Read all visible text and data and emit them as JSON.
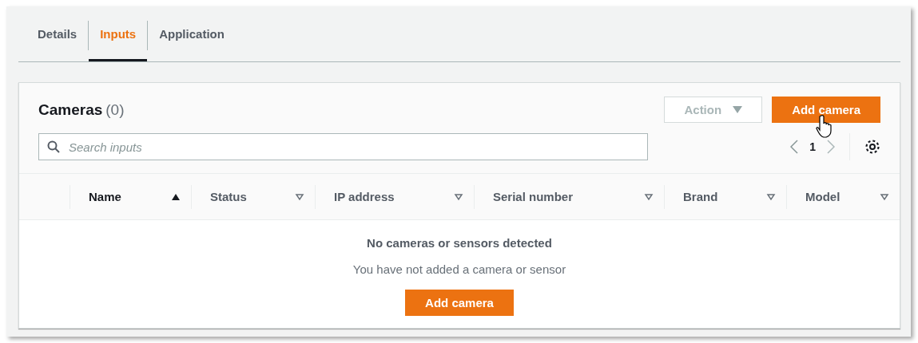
{
  "tabs": [
    {
      "label": "Details",
      "selected": false
    },
    {
      "label": "Inputs",
      "selected": true
    },
    {
      "label": "Application",
      "selected": false
    }
  ],
  "cameras": {
    "title": "Cameras",
    "count": "(0)",
    "action_button": {
      "label": "Action",
      "disabled": true
    },
    "add_button": {
      "label": "Add camera"
    },
    "search": {
      "placeholder": "Search inputs"
    },
    "pagination": {
      "page": "1"
    },
    "columns": [
      {
        "label": "Name",
        "sorted": true
      },
      {
        "label": "Status",
        "sorted": false
      },
      {
        "label": "IP address",
        "sorted": false
      },
      {
        "label": "Serial number",
        "sorted": false
      },
      {
        "label": "Brand",
        "sorted": false
      },
      {
        "label": "Model",
        "sorted": false
      }
    ],
    "empty": {
      "title": "No cameras or sensors detected",
      "message": "You have not added a camera or sensor",
      "button": "Add camera"
    }
  }
}
